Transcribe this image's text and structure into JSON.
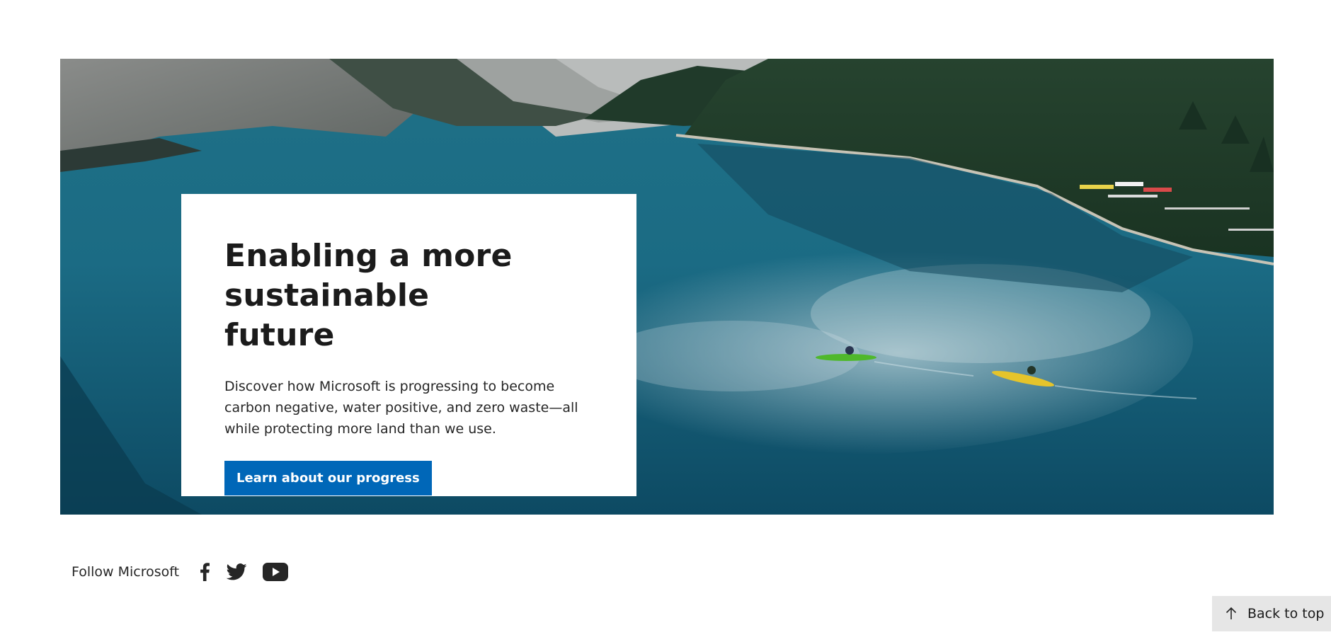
{
  "hero": {
    "title_line1": "Enabling a more",
    "title_line2": "sustainable future",
    "description": "Discover how Microsoft is progressing to become carbon negative, water positive, and zero waste—all while protecting more land than we use.",
    "cta_label": "Learn about our progress",
    "cta_color": "#0067b8"
  },
  "social": {
    "label": "Follow Microsoft",
    "links": [
      {
        "icon": "facebook-icon"
      },
      {
        "icon": "twitter-icon"
      },
      {
        "icon": "youtube-icon"
      }
    ]
  },
  "back_to_top": {
    "label": "Back to top",
    "icon": "arrow-up-icon"
  }
}
